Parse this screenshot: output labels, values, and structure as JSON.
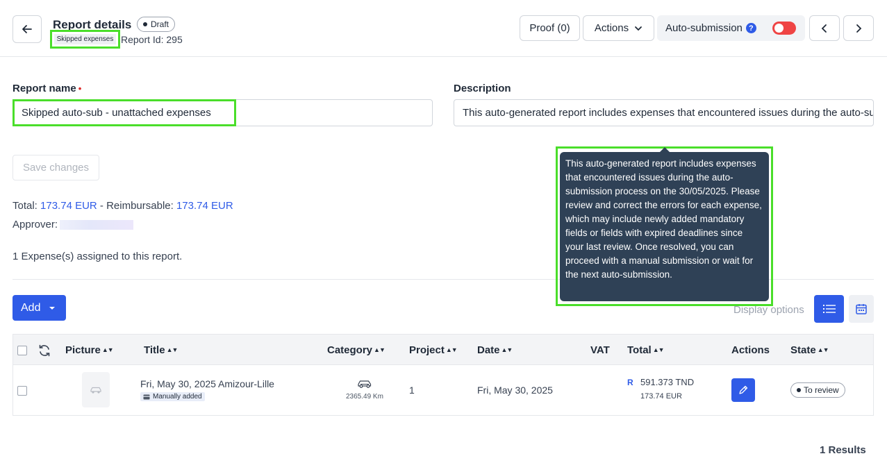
{
  "header": {
    "title": "Report details",
    "status": "Draft",
    "tag": "Skipped expenses",
    "report_id": "Report Id: 295",
    "proof_label": "Proof (0)",
    "actions_label": "Actions",
    "auto_submission_label": "Auto-submission",
    "help_glyph": "?",
    "auto_submission_enabled": false
  },
  "form": {
    "name_label": "Report name",
    "required_mark": "•",
    "name_value": "Skipped auto-sub - unattached expenses",
    "description_label": "Description",
    "description_value": "This auto-generated report includes expenses that encountered issues during the auto-submission process on the 30/05/2025.",
    "save_label": "Save changes"
  },
  "summary": {
    "total_label": "Total: ",
    "total_value": "173.74 EUR",
    "separator": " - Reimbursable: ",
    "reimbursable_value": "173.74 EUR",
    "approver_label": "Approver:",
    "assigned_text": "1 Expense(s) assigned to this report."
  },
  "toolbar": {
    "add_label": "Add",
    "display_options_label": "Display options"
  },
  "tooltip": {
    "text": "This auto-generated report includes expenses that encountered issues during the auto-submission process on the 30/05/2025. Please review and correct the errors for each expense, which may include newly added mandatory fields or fields with expired deadlines since your last review. Once resolved, you can proceed with a manual submission or wait for the next auto-submission."
  },
  "table": {
    "columns": {
      "picture": "Picture",
      "title": "Title",
      "category": "Category",
      "project": "Project",
      "date": "Date",
      "vat": "VAT",
      "total": "Total",
      "actions": "Actions",
      "state": "State"
    },
    "sort_glyph": "▲▼",
    "rows": [
      {
        "title": "Fri, May 30, 2025 Amizour-Lille",
        "badge": "Manually added",
        "category_icon": "car-icon",
        "category_detail": "2365.49 Km",
        "project": "1",
        "date": "Fri, May 30, 2025",
        "vat": "",
        "total_marker": "R",
        "total_primary": "591.373 TND",
        "total_secondary": "173.74 EUR",
        "state": "To review"
      }
    ]
  },
  "footer": {
    "results": "1 Results"
  },
  "colors": {
    "accent": "#2f5be7",
    "toggle_off": "#ef4444",
    "tooltip_bg": "#2f4156",
    "highlight": "#4ade2a"
  }
}
